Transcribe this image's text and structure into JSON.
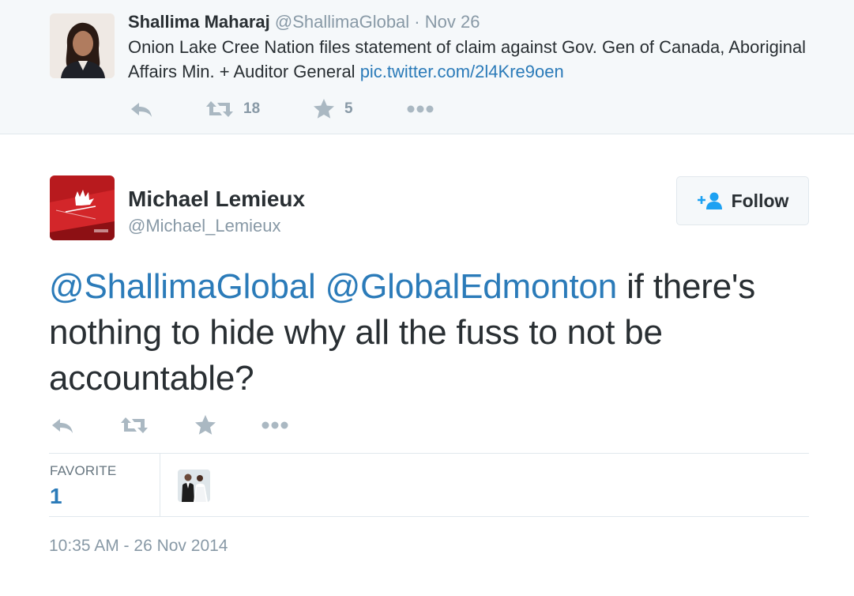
{
  "parent_tweet": {
    "author_name": "Shallima Maharaj",
    "author_handle": "@ShallimaGlobal",
    "separator": "·",
    "date": "Nov 26",
    "text_before": "Onion Lake Cree Nation files statement of claim against Gov. Gen of Canada, Aboriginal Affairs Min. + Auditor General ",
    "link": "pic.twitter.com/2l4Kre9oen",
    "retweet_count": "18",
    "favorite_count": "5"
  },
  "tweet": {
    "author_name": "Michael Lemieux",
    "author_handle": "@Michael_Lemieux",
    "follow_label": "Follow",
    "mention_1": "@ShallimaGlobal",
    "mention_2": "@GlobalEdmonton",
    "text_rest": " if there's nothing to hide why all the fuss to not be accountable?",
    "stats_label": "FAVORITE",
    "stats_count": "1",
    "timestamp": "10:35 AM - 26 Nov 2014"
  },
  "icons": {
    "reply": "reply-icon",
    "retweet": "retweet-icon",
    "favorite": "star-icon",
    "more": "more-icon",
    "follow": "add-user-icon"
  },
  "colors": {
    "link": "#2b7bb9",
    "icon": "#aab8c2",
    "muted": "#8899a6",
    "text": "#292f33",
    "parent_bg": "#f5f8fa"
  }
}
